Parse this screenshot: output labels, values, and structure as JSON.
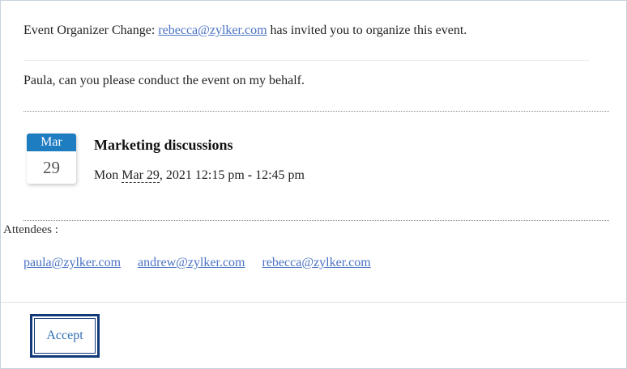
{
  "invite": {
    "prefix": "Event Organizer Change: ",
    "organizer_email": "rebecca@zylker.com",
    "suffix": " has invited you to organize this event."
  },
  "message": "Paula, can you please conduct the event on my behalf.",
  "calendar_badge": {
    "month": "Mar",
    "day": "29"
  },
  "event": {
    "title": "Marketing discussions",
    "weekday": "Mon ",
    "date": "Mar 29",
    "year_time": ", 2021 12:15 pm ",
    "dash": "-",
    "end_time": " 12:45 pm"
  },
  "attendees": {
    "label": "Attendees :",
    "emails": [
      "paula@zylker.com",
      "andrew@zylker.com",
      "rebecca@zylker.com"
    ]
  },
  "actions": {
    "accept_label": "Accept"
  },
  "colors": {
    "link": "#4a72c4",
    "calendar_header": "#1e7cc1",
    "button_border": "#123a79"
  }
}
